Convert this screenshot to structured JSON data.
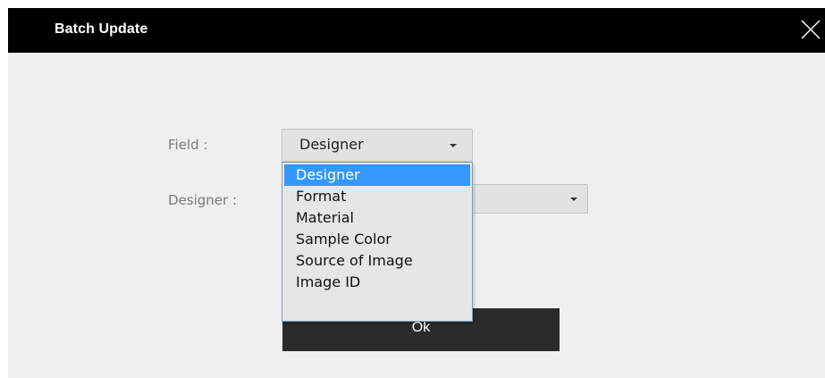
{
  "window": {
    "title": "Batch Update",
    "close_icon": "close-icon"
  },
  "form": {
    "field_label": "Field :",
    "field_value": "Designer",
    "designer_label": "Designer :",
    "designer_value": ""
  },
  "dropdown": {
    "options": [
      "Designer",
      "Format",
      "Material",
      "Sample Color",
      "Source of Image",
      "Image ID"
    ],
    "selected": "Designer",
    "highlight_color": "#3399ff"
  },
  "actions": {
    "ok_label": "Ok"
  }
}
